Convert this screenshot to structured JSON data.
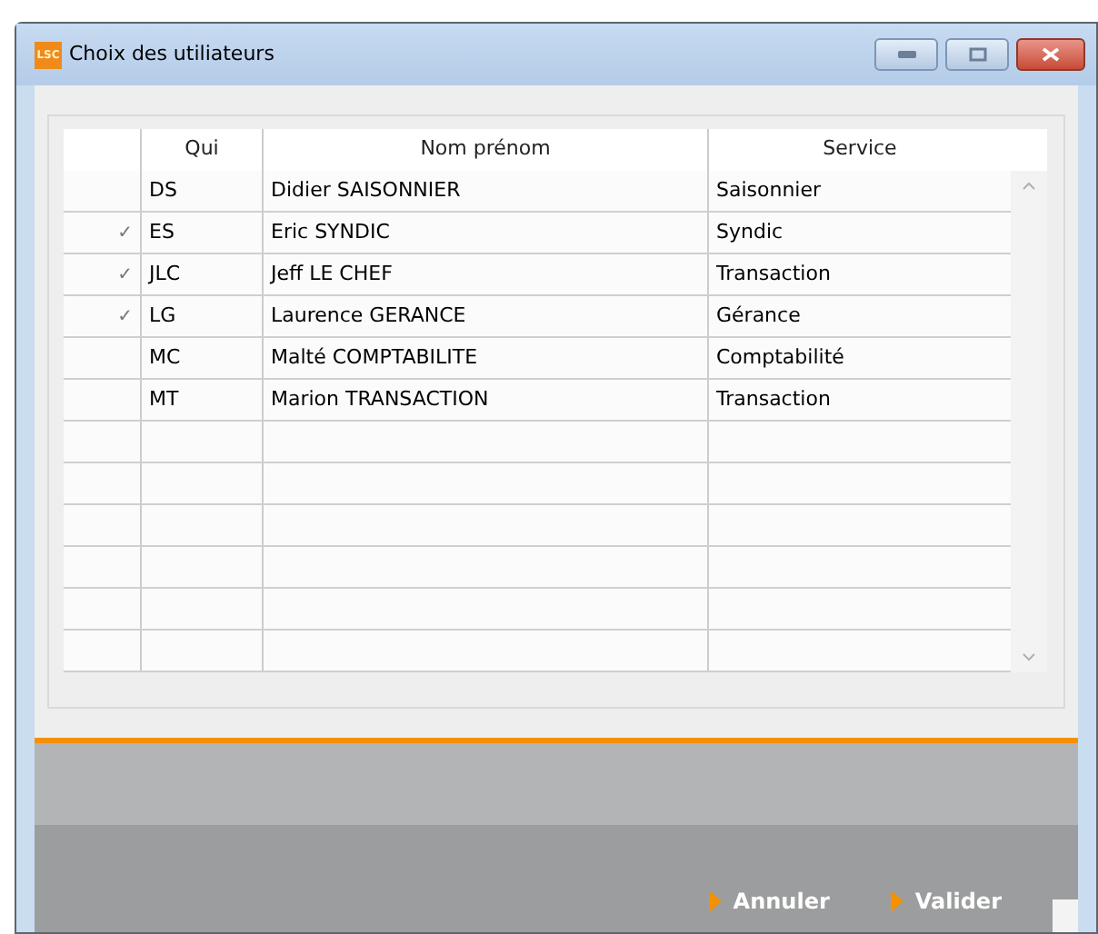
{
  "window": {
    "title": "Choix des utiliateurs",
    "icon_text": "LSC"
  },
  "table": {
    "columns": [
      "Qui",
      "Nom prénom",
      "Service"
    ],
    "rows": [
      {
        "checked": false,
        "cells": [
          "DS",
          "Didier SAISONNIER",
          "Saisonnier"
        ]
      },
      {
        "checked": true,
        "cells": [
          "ES",
          "Eric SYNDIC",
          "Syndic"
        ]
      },
      {
        "checked": true,
        "cells": [
          "JLC",
          "Jeff LE CHEF",
          "Transaction"
        ]
      },
      {
        "checked": true,
        "cells": [
          "LG",
          "Laurence GERANCE",
          "Gérance"
        ]
      },
      {
        "checked": false,
        "cells": [
          "MC",
          "Malté COMPTABILITE",
          "Comptabilité"
        ]
      },
      {
        "checked": false,
        "cells": [
          "MT",
          "Marion TRANSACTION",
          "Transaction"
        ]
      }
    ],
    "check_mark": "✓"
  },
  "buttons": [
    "Annuler",
    "Valider"
  ]
}
